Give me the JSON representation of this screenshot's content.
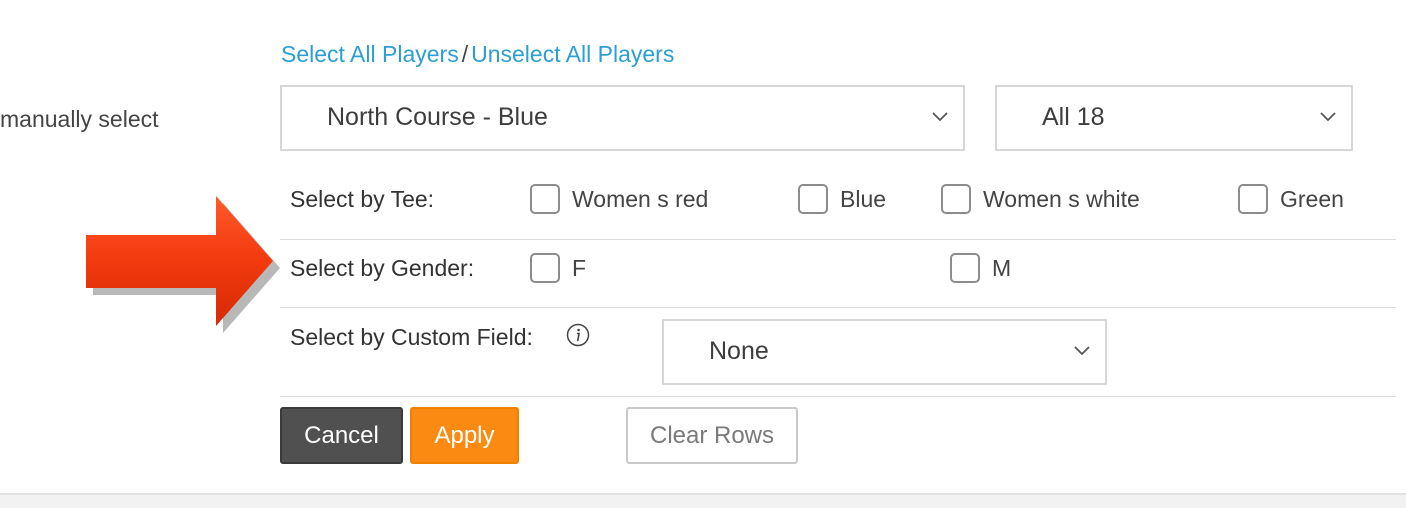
{
  "left_text": "manually select",
  "links": {
    "select_all": "Select All Players",
    "separator": "/",
    "unselect_all": "Unselect All Players"
  },
  "course_select": {
    "value": "North Course - Blue"
  },
  "holes_select": {
    "value": "All 18"
  },
  "tee_row": {
    "label": "Select by Tee:",
    "options": [
      "Women s red",
      "Blue",
      "Women s white",
      "Green"
    ]
  },
  "gender_row": {
    "label": "Select by Gender:",
    "options": [
      "F",
      "M"
    ]
  },
  "custom_row": {
    "label": "Select by Custom Field:",
    "select_value": "None",
    "info_icon": "info-circle-icon"
  },
  "buttons": {
    "cancel": "Cancel",
    "apply": "Apply",
    "clear": "Clear Rows"
  },
  "colors": {
    "link": "#2b9fd1",
    "apply": "#fb8a12",
    "cancel": "#505050",
    "arrow": "#f03a10"
  },
  "decor": {
    "arrow_icon": "red-arrow-right-icon"
  }
}
